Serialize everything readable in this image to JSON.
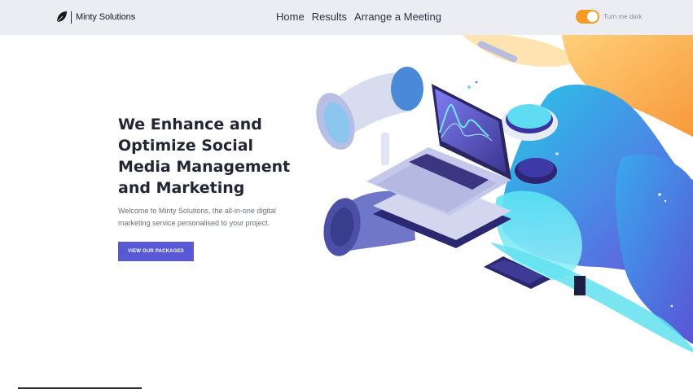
{
  "brand": {
    "name": "Minty Solutions",
    "icon": "leaf-icon"
  },
  "nav": {
    "items": [
      "Home",
      "Results",
      "Arrange a Meeting"
    ]
  },
  "theme_toggle": {
    "label": "Turn me dark",
    "on": true,
    "color": "#f49a26"
  },
  "hero": {
    "title": "We Enhance and Optimize Social Media Management and Marketing",
    "description": "Welcome to Minty Solutions, the all-in-one digital marketing service personalised to your project.",
    "cta_label": "VIEW OUR PACKAGES"
  },
  "colors": {
    "accent": "#5959d6",
    "topbar": "#ebedf3",
    "toggle": "#f49a26"
  }
}
